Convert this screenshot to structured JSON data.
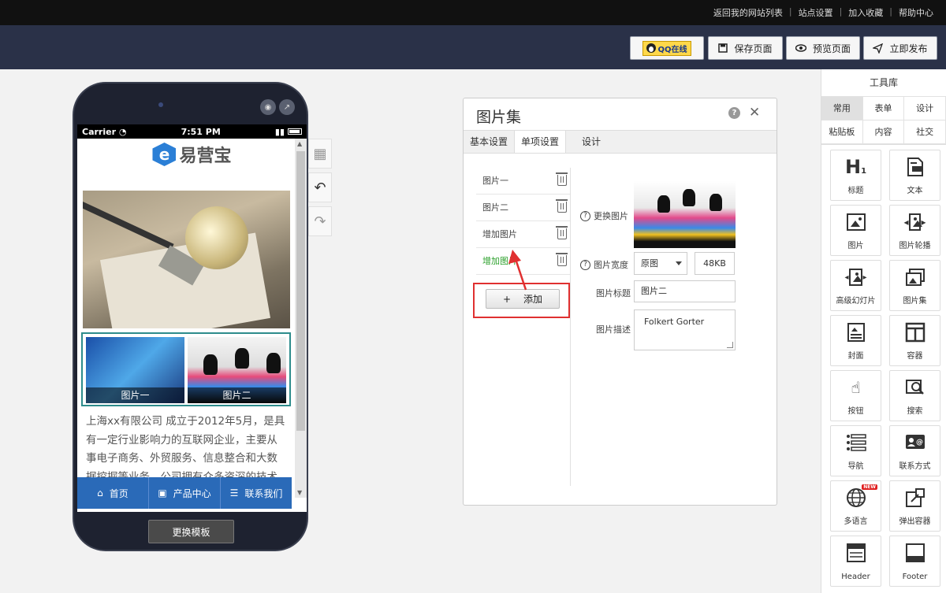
{
  "toplinks": [
    "返回我的网站列表",
    "站点设置",
    "加入收藏",
    "帮助中心"
  ],
  "header": {
    "qq_label": "QQ在线",
    "save_label": "保存页面",
    "preview_label": "预览页面",
    "publish_label": "立即发布"
  },
  "phone": {
    "carrier": "Carrier",
    "time": "7:51 PM",
    "logo_text": "易营宝",
    "gallery": [
      {
        "caption": "图片一"
      },
      {
        "caption": "图片二"
      }
    ],
    "body_text": "上海xx有限公司 成立于2012年5月，是具有一定行业影响力的互联网企业，主要从事电子商务、外贸服务、信息整合和大数据挖掘等业务。公司拥有众多资深的技术",
    "tabs": [
      {
        "label": "首页",
        "icon": "home-icon"
      },
      {
        "label": "产品中心",
        "icon": "product-icon"
      },
      {
        "label": "联系我们",
        "icon": "list-icon"
      }
    ],
    "change_template_label": "更换模板"
  },
  "panel": {
    "title": "图片集",
    "tabs": [
      "基本设置",
      "单项设置",
      "设计"
    ],
    "active_tab": "单项设置",
    "items": [
      {
        "label": "图片一",
        "color": "#444444"
      },
      {
        "label": "图片二",
        "color": "#444444"
      },
      {
        "label": "增加图片",
        "color": "#444444"
      },
      {
        "label": "增加图片",
        "color": "#2ba02b"
      }
    ],
    "add_label": "添加",
    "replace_label": "更换图片",
    "width_label": "图片宽度",
    "width_value": "原图",
    "size_value": "48KB",
    "title_label": "图片标题",
    "title_value": "图片二",
    "desc_label": "图片描述",
    "desc_value": "Folkert Gorter"
  },
  "toolbox": {
    "title": "工具库",
    "tabs": [
      "常用",
      "表单",
      "设计",
      "粘贴板",
      "内容",
      "社交"
    ],
    "active_tab": "常用",
    "tools": [
      {
        "label": "标题",
        "icon": "heading-icon"
      },
      {
        "label": "文本",
        "icon": "text-icon"
      },
      {
        "label": "图片",
        "icon": "image-icon"
      },
      {
        "label": "图片轮播",
        "icon": "carousel-icon"
      },
      {
        "label": "高级幻灯片",
        "icon": "slideshow-icon"
      },
      {
        "label": "图片集",
        "icon": "gallery-icon"
      },
      {
        "label": "封面",
        "icon": "cover-icon"
      },
      {
        "label": "容器",
        "icon": "container-icon"
      },
      {
        "label": "按钮",
        "icon": "button-icon"
      },
      {
        "label": "搜索",
        "icon": "search-icon"
      },
      {
        "label": "导航",
        "icon": "nav-icon"
      },
      {
        "label": "联系方式",
        "icon": "contact-icon"
      },
      {
        "label": "多语言",
        "icon": "globe-icon",
        "badge": "NEW"
      },
      {
        "label": "弹出容器",
        "icon": "popup-icon"
      },
      {
        "label": "Header",
        "icon": "header-icon"
      },
      {
        "label": "Footer",
        "icon": "footer-icon"
      }
    ]
  }
}
